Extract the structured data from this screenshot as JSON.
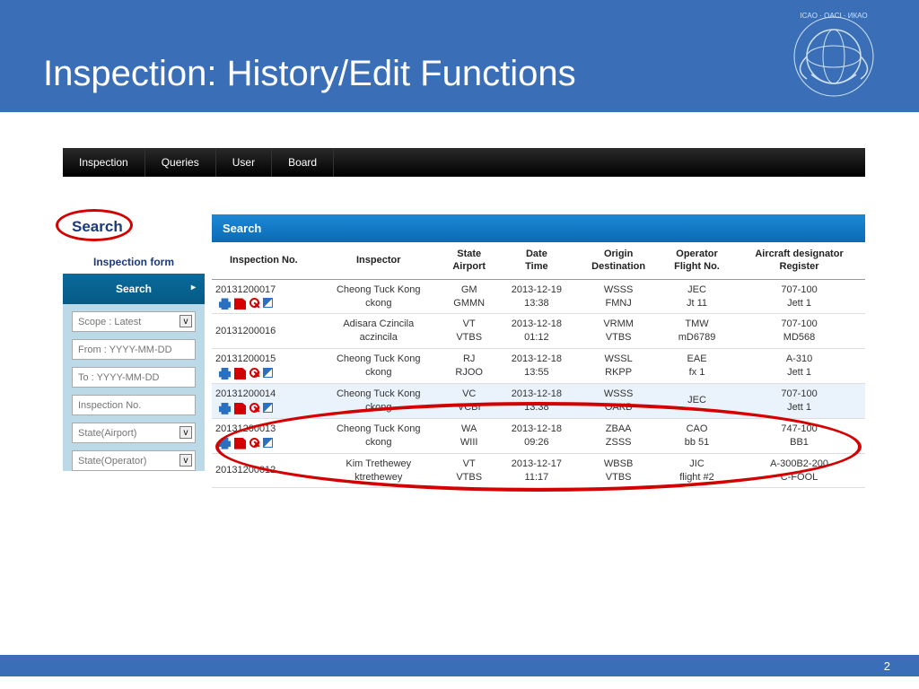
{
  "banner": {
    "title": "Inspection: History/Edit Functions"
  },
  "menu": {
    "items": [
      "Inspection",
      "Queries",
      "User",
      "Board"
    ]
  },
  "sidebar": {
    "search_label": "Search",
    "form_label": "Inspection form",
    "search_button": "Search",
    "scope_placeholder": "Scope : Latest",
    "from_placeholder": "From : YYYY-MM-DD",
    "to_placeholder": "To : YYYY-MM-DD",
    "inspno_placeholder": "Inspection No.",
    "stateairport_placeholder": "State(Airport)",
    "stateoperator_placeholder": "State(Operator)"
  },
  "results": {
    "header": "Search",
    "columns": {
      "c0": "Inspection No.",
      "c1": "Inspector",
      "c2a": "State",
      "c2b": "Airport",
      "c3a": "Date",
      "c3b": "Time",
      "c4a": "Origin",
      "c4b": "Destination",
      "c5a": "Operator",
      "c5b": "Flight No.",
      "c6a": "Aircraft designator",
      "c6b": "Register"
    },
    "rows": [
      {
        "no": "20131200017",
        "icons": true,
        "insp1": "Cheong Tuck Kong",
        "insp2": "ckong",
        "st1": "GM",
        "st2": "GMMN",
        "dt1": "2013-12-19",
        "dt2": "13:38",
        "od1": "WSSS",
        "od2": "FMNJ",
        "op1": "JEC",
        "op2": "Jt 11",
        "ac1": "707-100",
        "ac2": "Jett 1"
      },
      {
        "no": "20131200016",
        "icons": false,
        "insp1": "Adisara Czincila",
        "insp2": "aczincila",
        "st1": "VT",
        "st2": "VTBS",
        "dt1": "2013-12-18",
        "dt2": "01:12",
        "od1": "VRMM",
        "od2": "VTBS",
        "op1": "TMW",
        "op2": "mD6789",
        "ac1": "707-100",
        "ac2": "MD568"
      },
      {
        "no": "20131200015",
        "icons": true,
        "insp1": "Cheong Tuck Kong",
        "insp2": "ckong",
        "st1": "RJ",
        "st2": "RJOO",
        "dt1": "2013-12-18",
        "dt2": "13:55",
        "od1": "WSSL",
        "od2": "RKPP",
        "op1": "EAE",
        "op2": "fx 1",
        "ac1": "A-310",
        "ac2": "Jett 1"
      },
      {
        "no": "20131200014",
        "icons": true,
        "hl": true,
        "insp1": "Cheong Tuck Kong",
        "insp2": "ckong",
        "st1": "VC",
        "st2": "VCBI",
        "dt1": "2013-12-18",
        "dt2": "13:38",
        "od1": "WSSS",
        "od2": "OAKB",
        "op1": "JEC",
        "op2": "",
        "ac1": "707-100",
        "ac2": "Jett 1"
      },
      {
        "no": "20131200013",
        "icons": true,
        "insp1": "Cheong Tuck Kong",
        "insp2": "ckong",
        "st1": "WA",
        "st2": "WIII",
        "dt1": "2013-12-18",
        "dt2": "09:26",
        "od1": "ZBAA",
        "od2": "ZSSS",
        "op1": "CAO",
        "op2": "bb 51",
        "ac1": "747-100",
        "ac2": "BB1"
      },
      {
        "no": "20131200012",
        "icons": false,
        "insp1": "Kim Trethewey",
        "insp2": "ktrethewey",
        "st1": "VT",
        "st2": "VTBS",
        "dt1": "2013-12-17",
        "dt2": "11:17",
        "od1": "WBSB",
        "od2": "VTBS",
        "op1": "JIC",
        "op2": "flight #2",
        "ac1": "A-300B2-200",
        "ac2": "C-FOOL"
      }
    ]
  },
  "page": {
    "number": "2"
  }
}
